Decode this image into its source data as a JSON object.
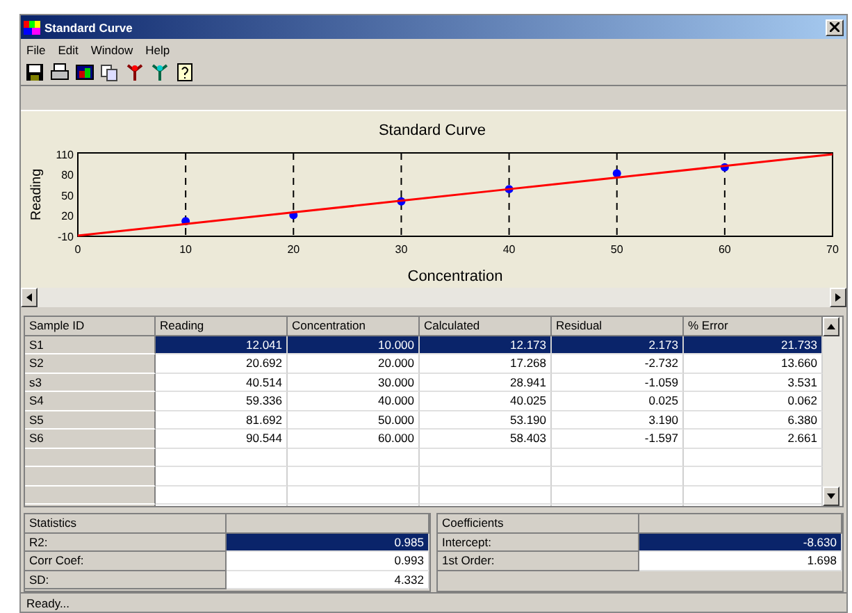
{
  "window": {
    "title": "Standard Curve"
  },
  "menu": [
    "File",
    "Edit",
    "Window",
    "Help"
  ],
  "toolbar": [
    {
      "kind": "save"
    },
    {
      "kind": "print"
    },
    {
      "kind": "image"
    },
    {
      "kind": "copy"
    },
    {
      "kind": "plant-red"
    },
    {
      "kind": "plant-teal"
    },
    {
      "kind": "help"
    }
  ],
  "chart": {
    "chart_data": {
      "type": "scatter",
      "title": "Standard Curve",
      "xlabel": "Concentration",
      "ylabel": "Reading",
      "x": [
        0,
        10,
        20,
        30,
        40,
        50,
        60,
        70
      ],
      "xlim": [
        0,
        70
      ],
      "ylim": [
        -10,
        112
      ],
      "xticks": [
        0,
        10,
        20,
        30,
        40,
        50,
        60,
        70
      ],
      "yticks": [
        -10,
        20,
        50,
        80,
        110
      ],
      "grid": true,
      "series": [
        {
          "type": "scatter",
          "color": "#0000ff",
          "values": [
            null,
            12,
            21,
            41,
            59,
            82,
            91,
            null
          ]
        },
        {
          "type": "line",
          "color": "#ff0000",
          "values": [
            -9,
            8,
            25,
            42,
            59,
            76,
            93,
            110
          ]
        }
      ]
    }
  },
  "table": {
    "columns": [
      "Sample ID",
      "Reading",
      "Concentration",
      "Calculated",
      "Residual",
      "% Error"
    ],
    "rows": [
      {
        "selected": true,
        "cells": [
          "S1",
          "12.041",
          "10.000",
          "12.173",
          "2.173",
          "21.733"
        ]
      },
      {
        "selected": false,
        "cells": [
          "S2",
          "20.692",
          "20.000",
          "17.268",
          "-2.732",
          "13.660"
        ]
      },
      {
        "selected": false,
        "cells": [
          "s3",
          "40.514",
          "30.000",
          "28.941",
          "-1.059",
          "3.531"
        ]
      },
      {
        "selected": false,
        "cells": [
          "S4",
          "59.336",
          "40.000",
          "40.025",
          "0.025",
          "0.062"
        ]
      },
      {
        "selected": false,
        "cells": [
          "S5",
          "81.692",
          "50.000",
          "53.190",
          "3.190",
          "6.380"
        ]
      },
      {
        "selected": false,
        "cells": [
          "S6",
          "90.544",
          "60.000",
          "58.403",
          "-1.597",
          "2.661"
        ]
      }
    ]
  },
  "statistics": {
    "title": "Statistics",
    "rows": [
      {
        "label": "R2:",
        "value": "0.985",
        "selected": true
      },
      {
        "label": "Corr Coef:",
        "value": "0.993",
        "selected": false
      },
      {
        "label": "SD:",
        "value": "4.332",
        "selected": false
      }
    ]
  },
  "coefficients": {
    "title": "Coefficients",
    "rows": [
      {
        "label": "Intercept:",
        "value": "-8.630",
        "selected": true
      },
      {
        "label": "1st Order:",
        "value": "1.698",
        "selected": false
      }
    ]
  },
  "status_bar": "Ready..."
}
